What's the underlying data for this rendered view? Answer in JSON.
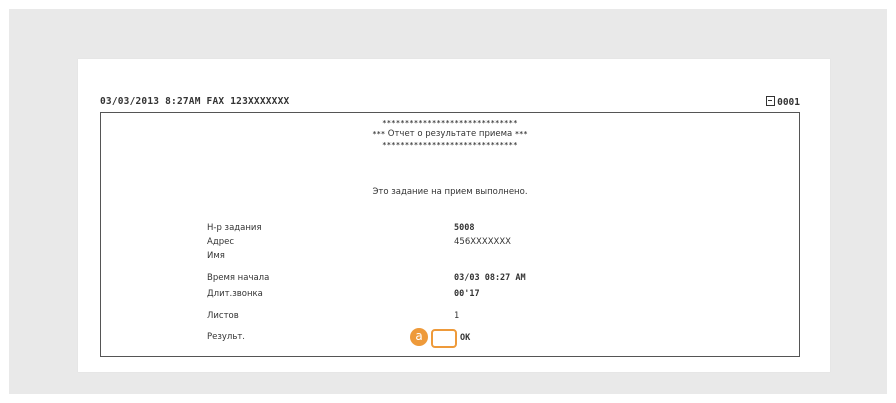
{
  "report": {
    "header_left": "03/03/2013 8:27AM FAX 123XXXXXXX",
    "header_page": "0001",
    "stars_top": "******************************",
    "title_prefix": "***",
    "title": "Отчет о результате приема",
    "title_suffix": "***",
    "stars_bottom": "******************************",
    "message": "Это задание на прием выполнено.",
    "fields": [
      {
        "label": "Н-р задания",
        "value": "5008"
      },
      {
        "label": "Адрес",
        "value": "456XXXXXXX"
      },
      {
        "label": "Имя",
        "value": ""
      },
      {
        "label": "Время начала",
        "value": "03/03 08:27 AM"
      },
      {
        "label": "Длит.звонка",
        "value": "00'17"
      },
      {
        "label": "Листов",
        "value": "1"
      },
      {
        "label": "Результ.",
        "value": "OK"
      }
    ],
    "callout_letter": "a"
  },
  "colors": {
    "callout": "#ee9a3a",
    "background": "#e9e9e9"
  }
}
